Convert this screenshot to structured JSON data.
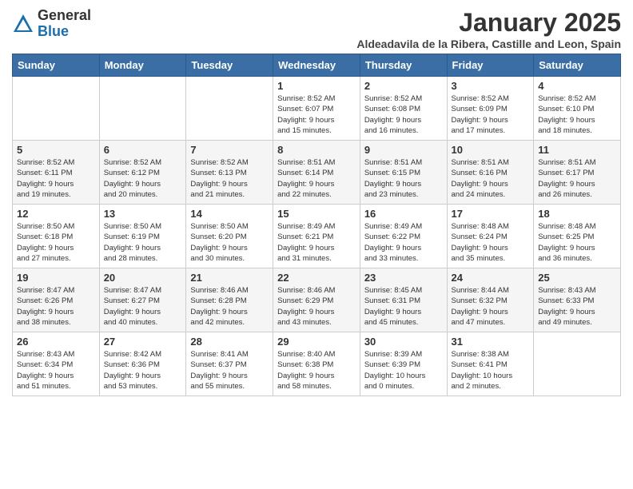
{
  "header": {
    "logo_general": "General",
    "logo_blue": "Blue",
    "title": "January 2025",
    "subtitle": "Aldeadavila de la Ribera, Castille and Leon, Spain"
  },
  "weekdays": [
    "Sunday",
    "Monday",
    "Tuesday",
    "Wednesday",
    "Thursday",
    "Friday",
    "Saturday"
  ],
  "weeks": [
    [
      {
        "day": "",
        "info": ""
      },
      {
        "day": "",
        "info": ""
      },
      {
        "day": "",
        "info": ""
      },
      {
        "day": "1",
        "info": "Sunrise: 8:52 AM\nSunset: 6:07 PM\nDaylight: 9 hours\nand 15 minutes."
      },
      {
        "day": "2",
        "info": "Sunrise: 8:52 AM\nSunset: 6:08 PM\nDaylight: 9 hours\nand 16 minutes."
      },
      {
        "day": "3",
        "info": "Sunrise: 8:52 AM\nSunset: 6:09 PM\nDaylight: 9 hours\nand 17 minutes."
      },
      {
        "day": "4",
        "info": "Sunrise: 8:52 AM\nSunset: 6:10 PM\nDaylight: 9 hours\nand 18 minutes."
      }
    ],
    [
      {
        "day": "5",
        "info": "Sunrise: 8:52 AM\nSunset: 6:11 PM\nDaylight: 9 hours\nand 19 minutes."
      },
      {
        "day": "6",
        "info": "Sunrise: 8:52 AM\nSunset: 6:12 PM\nDaylight: 9 hours\nand 20 minutes."
      },
      {
        "day": "7",
        "info": "Sunrise: 8:52 AM\nSunset: 6:13 PM\nDaylight: 9 hours\nand 21 minutes."
      },
      {
        "day": "8",
        "info": "Sunrise: 8:51 AM\nSunset: 6:14 PM\nDaylight: 9 hours\nand 22 minutes."
      },
      {
        "day": "9",
        "info": "Sunrise: 8:51 AM\nSunset: 6:15 PM\nDaylight: 9 hours\nand 23 minutes."
      },
      {
        "day": "10",
        "info": "Sunrise: 8:51 AM\nSunset: 6:16 PM\nDaylight: 9 hours\nand 24 minutes."
      },
      {
        "day": "11",
        "info": "Sunrise: 8:51 AM\nSunset: 6:17 PM\nDaylight: 9 hours\nand 26 minutes."
      }
    ],
    [
      {
        "day": "12",
        "info": "Sunrise: 8:50 AM\nSunset: 6:18 PM\nDaylight: 9 hours\nand 27 minutes."
      },
      {
        "day": "13",
        "info": "Sunrise: 8:50 AM\nSunset: 6:19 PM\nDaylight: 9 hours\nand 28 minutes."
      },
      {
        "day": "14",
        "info": "Sunrise: 8:50 AM\nSunset: 6:20 PM\nDaylight: 9 hours\nand 30 minutes."
      },
      {
        "day": "15",
        "info": "Sunrise: 8:49 AM\nSunset: 6:21 PM\nDaylight: 9 hours\nand 31 minutes."
      },
      {
        "day": "16",
        "info": "Sunrise: 8:49 AM\nSunset: 6:22 PM\nDaylight: 9 hours\nand 33 minutes."
      },
      {
        "day": "17",
        "info": "Sunrise: 8:48 AM\nSunset: 6:24 PM\nDaylight: 9 hours\nand 35 minutes."
      },
      {
        "day": "18",
        "info": "Sunrise: 8:48 AM\nSunset: 6:25 PM\nDaylight: 9 hours\nand 36 minutes."
      }
    ],
    [
      {
        "day": "19",
        "info": "Sunrise: 8:47 AM\nSunset: 6:26 PM\nDaylight: 9 hours\nand 38 minutes."
      },
      {
        "day": "20",
        "info": "Sunrise: 8:47 AM\nSunset: 6:27 PM\nDaylight: 9 hours\nand 40 minutes."
      },
      {
        "day": "21",
        "info": "Sunrise: 8:46 AM\nSunset: 6:28 PM\nDaylight: 9 hours\nand 42 minutes."
      },
      {
        "day": "22",
        "info": "Sunrise: 8:46 AM\nSunset: 6:29 PM\nDaylight: 9 hours\nand 43 minutes."
      },
      {
        "day": "23",
        "info": "Sunrise: 8:45 AM\nSunset: 6:31 PM\nDaylight: 9 hours\nand 45 minutes."
      },
      {
        "day": "24",
        "info": "Sunrise: 8:44 AM\nSunset: 6:32 PM\nDaylight: 9 hours\nand 47 minutes."
      },
      {
        "day": "25",
        "info": "Sunrise: 8:43 AM\nSunset: 6:33 PM\nDaylight: 9 hours\nand 49 minutes."
      }
    ],
    [
      {
        "day": "26",
        "info": "Sunrise: 8:43 AM\nSunset: 6:34 PM\nDaylight: 9 hours\nand 51 minutes."
      },
      {
        "day": "27",
        "info": "Sunrise: 8:42 AM\nSunset: 6:36 PM\nDaylight: 9 hours\nand 53 minutes."
      },
      {
        "day": "28",
        "info": "Sunrise: 8:41 AM\nSunset: 6:37 PM\nDaylight: 9 hours\nand 55 minutes."
      },
      {
        "day": "29",
        "info": "Sunrise: 8:40 AM\nSunset: 6:38 PM\nDaylight: 9 hours\nand 58 minutes."
      },
      {
        "day": "30",
        "info": "Sunrise: 8:39 AM\nSunset: 6:39 PM\nDaylight: 10 hours\nand 0 minutes."
      },
      {
        "day": "31",
        "info": "Sunrise: 8:38 AM\nSunset: 6:41 PM\nDaylight: 10 hours\nand 2 minutes."
      },
      {
        "day": "",
        "info": ""
      }
    ]
  ]
}
